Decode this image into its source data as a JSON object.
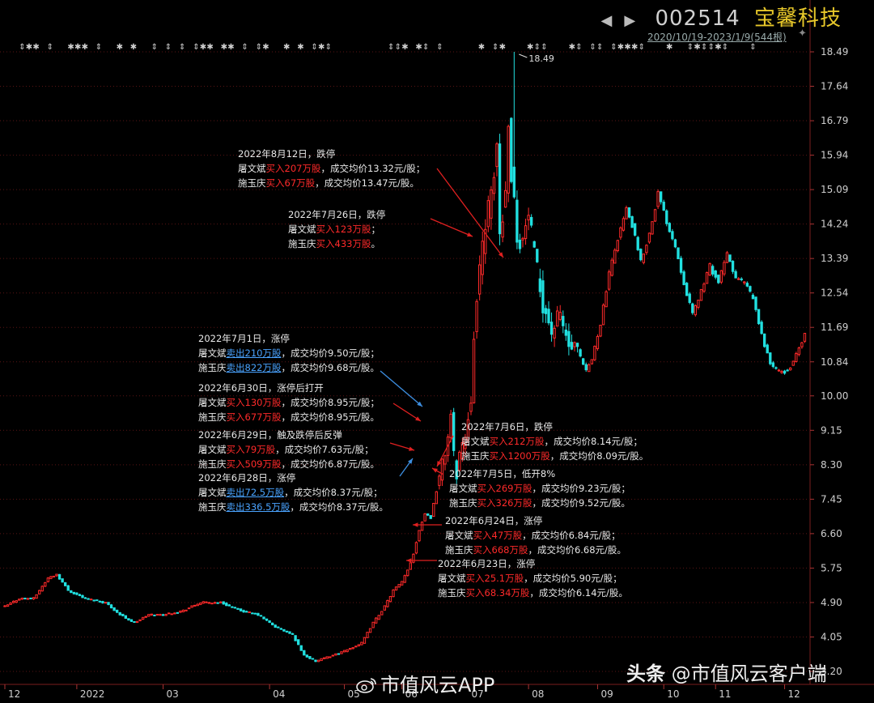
{
  "header": {
    "code": "002514",
    "name": "宝馨科技",
    "range": "2020/10/19-2023/1/9(544根)"
  },
  "chart_data": {
    "type": "bar",
    "style": "candlestick",
    "y_ticks": [
      "18.49",
      "17.64",
      "16.79",
      "15.94",
      "15.09",
      "14.24",
      "13.39",
      "12.54",
      "11.69",
      "10.84",
      "10.00",
      "9.15",
      "8.30",
      "7.45",
      "6.60",
      "5.75",
      "4.90",
      "4.05",
      "3.20"
    ],
    "ylim": [
      3.2,
      18.49
    ],
    "x_ticks": [
      {
        "label": "12",
        "day": 0
      },
      {
        "label": "2022",
        "day": 25
      },
      {
        "label": "03",
        "day": 55
      },
      {
        "label": "04",
        "day": 92
      },
      {
        "label": "05",
        "day": 118
      },
      {
        "label": "06",
        "day": 138
      },
      {
        "label": "07",
        "day": 161
      },
      {
        "label": "08",
        "day": 182
      },
      {
        "label": "09",
        "day": 206
      },
      {
        "label": "10",
        "day": 229
      },
      {
        "label": "11",
        "day": 247
      },
      {
        "label": "12",
        "day": 271
      }
    ],
    "max_label": "18.49",
    "up_color": "#ff2a2a",
    "down_color": "#21e0e0",
    "anchors": [
      [
        0,
        4.8
      ],
      [
        5,
        5.0
      ],
      [
        10,
        5.0
      ],
      [
        15,
        5.5
      ],
      [
        18,
        5.6
      ],
      [
        22,
        5.2
      ],
      [
        28,
        5.0
      ],
      [
        35,
        4.9
      ],
      [
        40,
        4.6
      ],
      [
        45,
        4.4
      ],
      [
        50,
        4.6
      ],
      [
        55,
        4.6
      ],
      [
        62,
        4.7
      ],
      [
        68,
        4.9
      ],
      [
        75,
        4.9
      ],
      [
        82,
        4.7
      ],
      [
        88,
        4.6
      ],
      [
        94,
        4.3
      ],
      [
        100,
        4.1
      ],
      [
        104,
        3.6
      ],
      [
        108,
        3.45
      ],
      [
        112,
        3.55
      ],
      [
        118,
        3.7
      ],
      [
        124,
        3.9
      ],
      [
        128,
        4.4
      ],
      [
        132,
        4.8
      ],
      [
        135,
        5.2
      ],
      [
        138,
        5.4
      ],
      [
        140,
        5.7
      ],
      [
        142,
        6.1
      ],
      [
        144,
        6.7
      ],
      [
        146,
        7.1
      ],
      [
        148,
        7.0
      ],
      [
        151,
        8.0
      ],
      [
        153,
        8.6
      ],
      [
        155,
        9.5
      ],
      [
        156,
        8.5
      ],
      [
        157,
        8.1
      ],
      [
        158,
        8.6
      ],
      [
        160,
        9.0
      ],
      [
        162,
        10.0
      ],
      [
        163,
        11.6
      ],
      [
        165,
        13.0
      ],
      [
        167,
        14.4
      ],
      [
        169,
        14.8
      ],
      [
        171,
        16.2
      ],
      [
        172,
        14.0
      ],
      [
        174,
        15.0
      ],
      [
        175,
        17.0
      ],
      [
        176,
        15.5
      ],
      [
        178,
        14.0
      ],
      [
        180,
        13.8
      ],
      [
        182,
        14.5
      ],
      [
        184,
        13.4
      ],
      [
        187,
        12.3
      ],
      [
        190,
        11.6
      ],
      [
        193,
        12.0
      ],
      [
        196,
        11.2
      ],
      [
        199,
        11.1
      ],
      [
        202,
        10.6
      ],
      [
        204,
        10.9
      ],
      [
        207,
        11.8
      ],
      [
        210,
        13.0
      ],
      [
        213,
        13.9
      ],
      [
        216,
        14.6
      ],
      [
        218,
        14.2
      ],
      [
        221,
        13.3
      ],
      [
        224,
        14.0
      ],
      [
        227,
        15.0
      ],
      [
        230,
        14.3
      ],
      [
        233,
        13.7
      ],
      [
        236,
        12.8
      ],
      [
        239,
        12.0
      ],
      [
        242,
        12.6
      ],
      [
        245,
        13.2
      ],
      [
        248,
        12.8
      ],
      [
        251,
        13.5
      ],
      [
        254,
        12.9
      ],
      [
        257,
        12.8
      ],
      [
        260,
        12.4
      ],
      [
        263,
        11.5
      ],
      [
        266,
        10.8
      ],
      [
        269,
        10.6
      ],
      [
        272,
        10.6
      ],
      [
        275,
        11.0
      ],
      [
        278,
        11.5
      ]
    ]
  },
  "annotations": [
    {
      "id": "a0812",
      "l1": "2022年8月12日，跌停",
      "p1": "屠文斌",
      "v1": "买入207万股",
      "t1": "，成交均价13.32元/股；",
      "p2": "施玉庆",
      "v2": "买入67万股",
      "t2": "，成交均价13.47元/股。"
    },
    {
      "id": "a0726",
      "l1": "2022年7月26日，跌停",
      "p1": "屠文斌",
      "v1": "买入123万股",
      "t1": "；",
      "p2": "施玉庆",
      "v2": "买入433万股",
      "t2": "。"
    },
    {
      "id": "a0701",
      "l1": "2022年7月1日，涨停",
      "sell": true,
      "p1": "屠文斌",
      "v1": "卖出210万股",
      "t1": "，成交均价9.50元/股；",
      "p2": "施玉庆",
      "v2": "卖出822万股",
      "t2": "，成交均价9.68元/股。"
    },
    {
      "id": "a0630",
      "l1": "2022年6月30日，涨停后打开",
      "p1": "屠文斌",
      "v1": "买入130万股",
      "t1": "，成交均价8.95元/股；",
      "p2": "施玉庆",
      "v2": "买入677万股",
      "t2": "，成交均价8.95元/股。"
    },
    {
      "id": "a0629",
      "l1": "2022年6月29日，触及跌停后反弹",
      "p1": "屠文斌",
      "v1": "买入79万股",
      "t1": "，成交均价7.63元/股；",
      "p2": "施玉庆",
      "v2": "买入509万股",
      "t2": "，成交均价6.87元/股。"
    },
    {
      "id": "a0628",
      "l1": "2022年6月28日，涨停",
      "sell": true,
      "p1": "屠文斌",
      "v1": "卖出72.5万股",
      "t1": "，成交均价8.37元/股；",
      "p2": "施玉庆",
      "v2": "卖出336.5万股",
      "t2": "，成交均价8.37元/股。"
    },
    {
      "id": "a0706",
      "l1": "2022年7月6日，跌停",
      "p1": "屠文斌",
      "v1": "买入212万股",
      "t1": "，成交均价8.14元/股；",
      "p2": "施玉庆",
      "v2": "买入1200万股",
      "t2": "，成交均价8.09元/股。"
    },
    {
      "id": "a0705",
      "l1": "2022年7月5日，低开8%",
      "p1": "屠文斌",
      "v1": "买入269万股",
      "t1": "，成交均价9.23元/股；",
      "p2": "施玉庆",
      "v2": "买入326万股",
      "t2": "，成交均价9.52元/股。"
    },
    {
      "id": "a0624",
      "l1": "2022年6月24日，涨停",
      "p1": "屠文斌",
      "v1": "买入47万股",
      "t1": "，成交均价6.84元/股；",
      "p2": "施玉庆",
      "v2": "买入668万股",
      "t2": "，成交均价6.68元/股。"
    },
    {
      "id": "a0623",
      "l1": "2022年6月23日，涨停",
      "p1": "屠文斌",
      "v1": "买入25.1万股",
      "t1": "，成交均价5.90元/股；",
      "p2": "施玉庆",
      "v2": "买入68.34万股",
      "t2": "，成交均价6.14元/股。"
    }
  ],
  "watermarks": {
    "weibo": "市值风云APP",
    "toutiao_bold": "头条",
    "toutiao_rest": " @市值风云客户端"
  },
  "icons": [
    "weibo-icon",
    "left-arrow-icon",
    "right-arrow-icon",
    "star-icon"
  ]
}
